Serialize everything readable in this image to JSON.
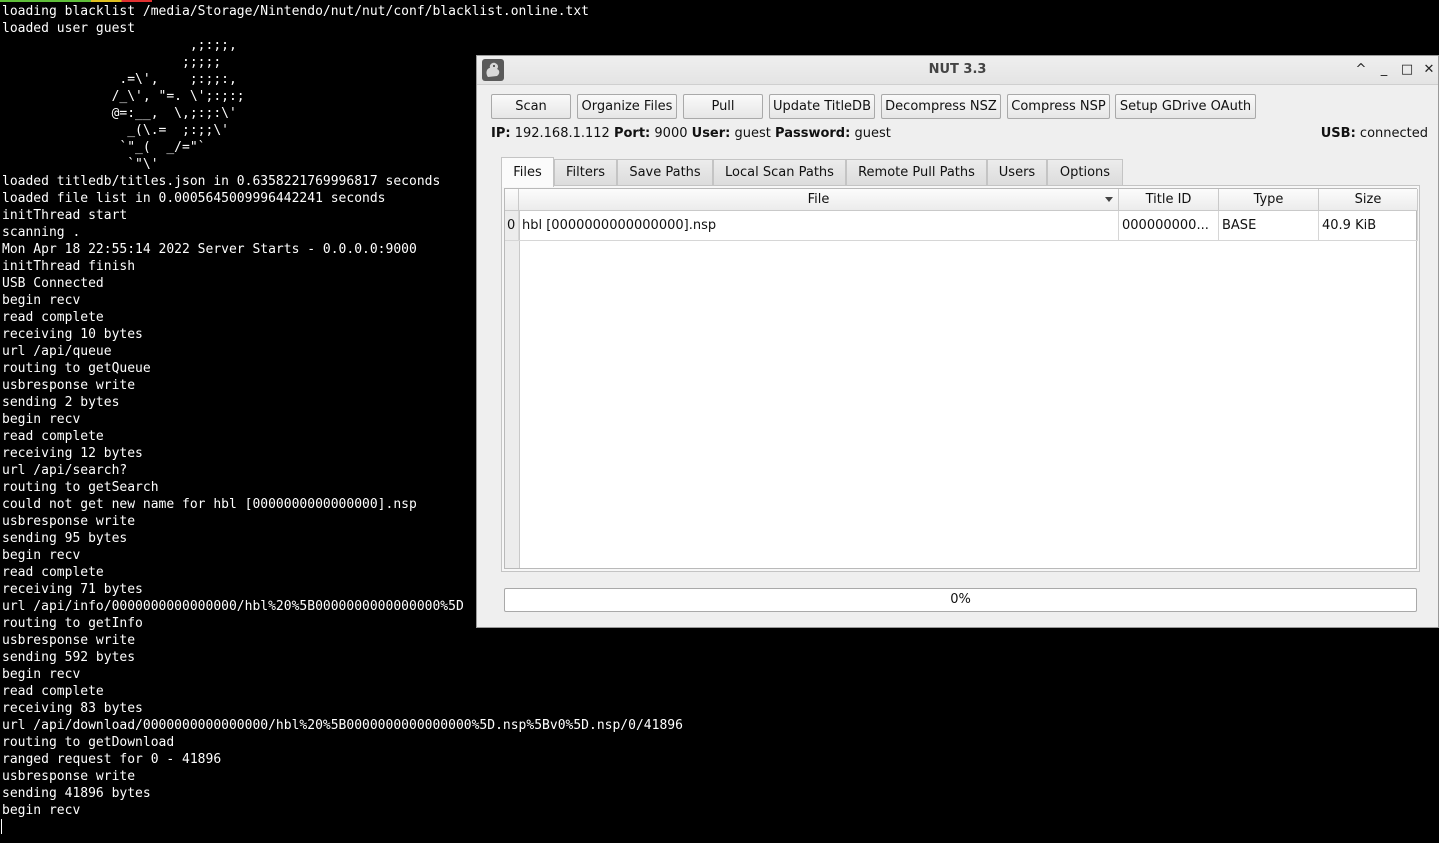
{
  "terminal": {
    "status_strip_colors": [
      "#5fbf3a",
      "#e0c020",
      "#e03030"
    ],
    "lines": [
      "loading blacklist /media/Storage/Nintendo/nut/nut/conf/blacklist.online.txt",
      "loaded user guest",
      "                        ,;:;;,",
      "                       ;;;;;",
      "               .=\\',    ;:;;:,",
      "              /_\\', \"=. \\';:;:;",
      "              @=:__,  \\,;:;:\\'",
      "                _(\\.=  ;:;;\\'",
      "               `\"_(  _/=\"`",
      "                `\"\\'",
      "loaded titledb/titles.json in 0.6358221769996817 seconds",
      "loaded file list in 0.0005645009996442241 seconds",
      "initThread start",
      "scanning .",
      "Mon Apr 18 22:55:14 2022 Server Starts - 0.0.0.0:9000",
      "initThread finish",
      "USB Connected",
      "begin recv",
      "read complete",
      "receiving 10 bytes",
      "url /api/queue",
      "routing to getQueue",
      "usbresponse write",
      "sending 2 bytes",
      "begin recv",
      "read complete",
      "receiving 12 bytes",
      "url /api/search?",
      "routing to getSearch",
      "could not get new name for hbl [0000000000000000].nsp",
      "usbresponse write",
      "sending 95 bytes",
      "begin recv",
      "read complete",
      "receiving 71 bytes",
      "url /api/info/0000000000000000/hbl%20%5B0000000000000000%5D",
      "routing to getInfo",
      "usbresponse write",
      "sending 592 bytes",
      "begin recv",
      "read complete",
      "receiving 83 bytes",
      "url /api/download/0000000000000000/hbl%20%5B0000000000000000%5D.nsp%5Bv0%5D.nsp/0/41896",
      "routing to getDownload",
      "ranged request for 0 - 41896",
      "usbresponse write",
      "sending 41896 bytes",
      "begin recv"
    ]
  },
  "window": {
    "title": "NUT 3.3",
    "app_icon": "squirrel-icon",
    "controls": {
      "up": "^",
      "minimize": "_",
      "maximize": "□",
      "close": "✕"
    }
  },
  "toolbar": {
    "buttons": [
      "Scan",
      "Organize Files",
      "Pull",
      "Update TitleDB",
      "Decompress NSZ",
      "Compress NSP",
      "Setup GDrive OAuth"
    ]
  },
  "info": {
    "ip_label": "IP:",
    "ip": "192.168.1.112",
    "port_label": "Port:",
    "port": "9000",
    "user_label": "User:",
    "user": "guest",
    "password_label": "Password:",
    "password": "guest",
    "usb_label": "USB:",
    "usb": "connected"
  },
  "tabs": [
    "Files",
    "Filters",
    "Save Paths",
    "Local Scan Paths",
    "Remote Pull Paths",
    "Users",
    "Options"
  ],
  "active_tab": "Files",
  "table": {
    "headers": [
      "File",
      "Title ID",
      "Type",
      "Size"
    ],
    "rows": [
      {
        "index": "0",
        "file": "hbl [0000000000000000].nsp",
        "title_id": "000000000...",
        "type": "BASE",
        "size": "40.9 KiB"
      }
    ]
  },
  "progress": {
    "value": 0,
    "label": "0%"
  }
}
